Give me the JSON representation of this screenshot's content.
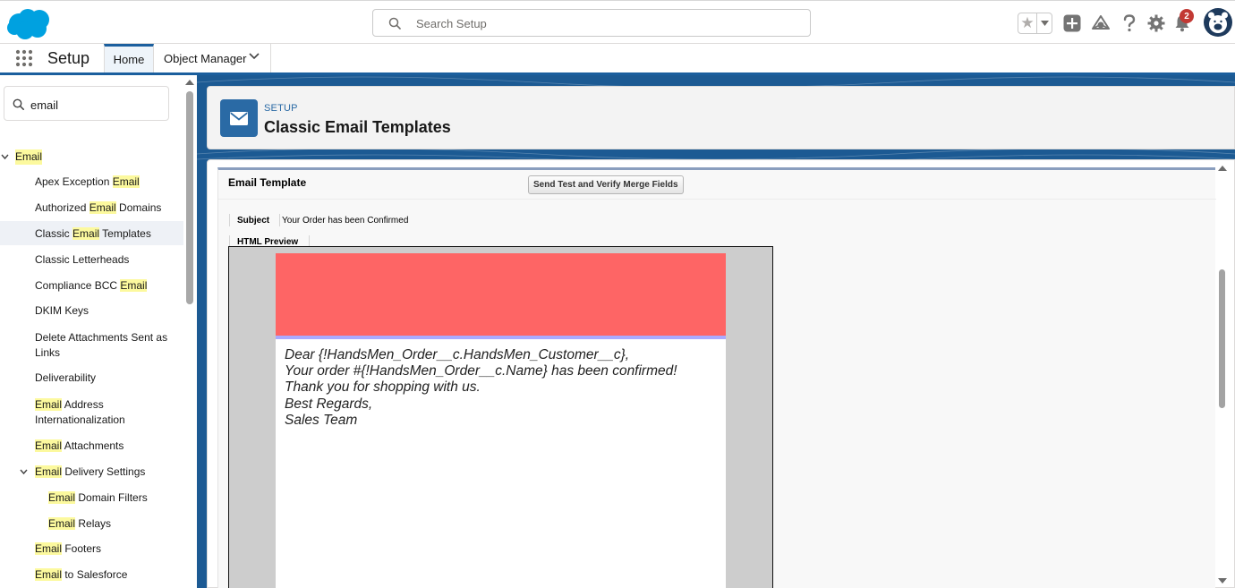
{
  "header": {
    "search_placeholder": "Search Setup",
    "notification_count": "2"
  },
  "nav": {
    "app_name": "Setup",
    "tabs": [
      {
        "label": "Home"
      },
      {
        "label": "Object Manager"
      }
    ]
  },
  "sidebar": {
    "quick_find_value": "email",
    "group_label": "Email",
    "items": [
      {
        "pre": "Apex Exception ",
        "hl": "Email",
        "post": ""
      },
      {
        "pre": "Authorized ",
        "hl": "Email",
        "post": " Domains"
      },
      {
        "pre": "Classic ",
        "hl": "Email",
        "post": " Templates"
      },
      {
        "pre": "Classic Letterheads",
        "hl": "",
        "post": ""
      },
      {
        "pre": "Compliance BCC ",
        "hl": "Email",
        "post": ""
      },
      {
        "pre": "DKIM Keys",
        "hl": "",
        "post": ""
      },
      {
        "pre": "Delete Attachments Sent as",
        "hl": "",
        "post": "",
        "line2": "Links"
      },
      {
        "pre": "Deliverability",
        "hl": "",
        "post": ""
      },
      {
        "pre": "",
        "hl": "Email",
        "post": " Address",
        "line2": "Internationalization"
      },
      {
        "pre": "",
        "hl": "Email",
        "post": " Attachments"
      },
      {
        "pre": "",
        "hl": "Email",
        "post": " Delivery Settings"
      },
      {
        "pre": "",
        "hl": "Email",
        "post": " Domain Filters"
      },
      {
        "pre": "",
        "hl": "Email",
        "post": " Relays"
      },
      {
        "pre": "",
        "hl": "Email",
        "post": " Footers"
      },
      {
        "pre": "",
        "hl": "Email",
        "post": " to Salesforce"
      }
    ]
  },
  "page_header": {
    "eyebrow": "SETUP",
    "title": "Classic Email Templates"
  },
  "template": {
    "section_title": "Email Template",
    "send_test_button": "Send Test and Verify Merge Fields",
    "subject_label": "Subject",
    "subject_value": "Your Order has been Confirmed",
    "html_preview_label": "HTML Preview",
    "body_lines": [
      "Dear {!HandsMen_Order__c.HandsMen_Customer__c},",
      "Your order #{!HandsMen_Order__c.Name} has been confirmed!",
      "Thank you for shopping with us.",
      "Best Regards,",
      "Sales Team"
    ],
    "header_color": "#fe6565",
    "bar_color": "#aaaaff"
  },
  "colors": {
    "brand": "#1b5f9e",
    "highlight": "#fcf99e",
    "icon_bg": "#2a6aa5"
  }
}
